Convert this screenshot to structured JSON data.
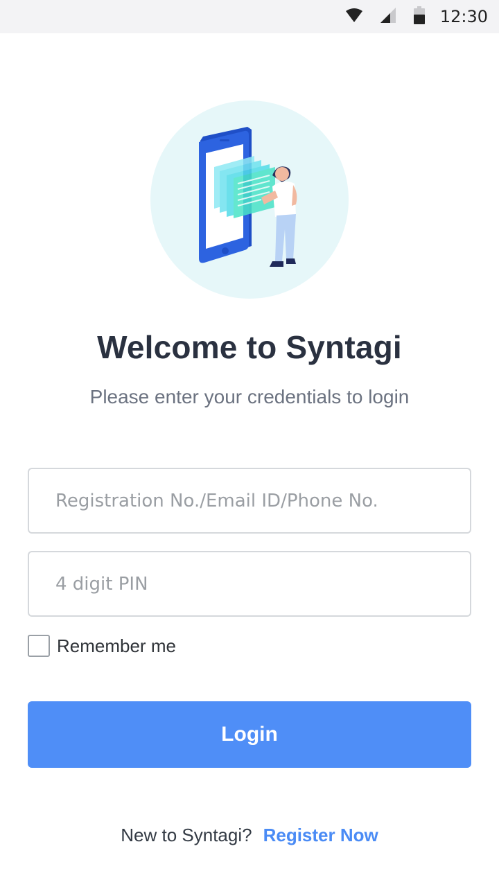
{
  "status_bar": {
    "time": "12:30",
    "icons": [
      "wifi-icon",
      "signal-icon",
      "battery-icon"
    ]
  },
  "hero": {
    "illustration": "phone-with-person-illustration"
  },
  "welcome": {
    "title": "Welcome to Syntagi",
    "subtitle": "Please enter your credentials to login"
  },
  "form": {
    "id_placeholder": "Registration No./Email ID/Phone No.",
    "id_value": "",
    "pin_placeholder": "4 digit PIN",
    "pin_value": "",
    "remember_label": "Remember me",
    "remember_checked": false,
    "login_label": "Login"
  },
  "footer": {
    "prompt": "New to Syntagi?",
    "register_label": "Register Now"
  },
  "colors": {
    "primary": "#4f8ef7",
    "link": "#4a8bf5",
    "hero_bg": "#e6f7f9"
  }
}
